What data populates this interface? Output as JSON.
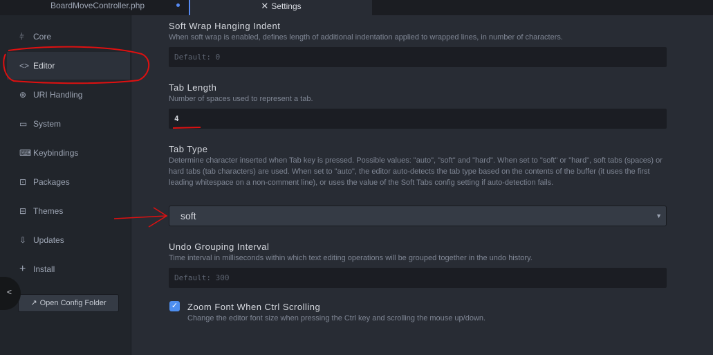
{
  "tabs": {
    "file": "BoardMoveController.php",
    "settings_icon": "tools-icon",
    "settings_glyph": "✕",
    "settings": "Settings"
  },
  "sidebar": {
    "items": [
      {
        "icon": "sliders-icon",
        "glyph": "⫩",
        "label": "Core"
      },
      {
        "icon": "code-icon",
        "glyph": "<>",
        "label": "Editor"
      },
      {
        "icon": "link-icon",
        "glyph": "⊕",
        "label": "URI Handling"
      },
      {
        "icon": "monitor-icon",
        "glyph": "▭",
        "label": "System"
      },
      {
        "icon": "keyboard-icon",
        "glyph": "⌨",
        "label": "Keybindings"
      },
      {
        "icon": "package-icon",
        "glyph": "⊡",
        "label": "Packages"
      },
      {
        "icon": "paintcan-icon",
        "glyph": "⊟",
        "label": "Themes"
      },
      {
        "icon": "cloud-download-icon",
        "glyph": "⇩",
        "label": "Updates"
      },
      {
        "icon": "plus-icon",
        "glyph": "+",
        "label": "Install"
      }
    ],
    "active": "Editor",
    "collapse_glyph": "<",
    "config_button_icon": "link-external-icon",
    "config_button_glyph": "↗",
    "config_button": "Open Config Folder"
  },
  "settings": {
    "soft_wrap": {
      "title": "Soft Wrap Hanging Indent",
      "description": "When soft wrap is enabled, defines length of additional indentation applied to wrapped lines, in number of characters.",
      "placeholder": "Default: 0"
    },
    "tab_length": {
      "title": "Tab Length",
      "description": "Number of spaces used to represent a tab.",
      "value": "4"
    },
    "tab_type": {
      "title": "Tab Type",
      "description": "Determine character inserted when Tab key is pressed. Possible values: \"auto\", \"soft\" and \"hard\". When set to \"soft\" or \"hard\", soft tabs (spaces) or hard tabs (tab characters) are used. When set to \"auto\", the editor auto-detects the tab type based on the contents of the buffer (it uses the first leading whitespace on a non-comment line), or uses the value of the Soft Tabs config setting if auto-detection fails.",
      "value": "soft",
      "arrow": "▼"
    },
    "undo_grouping": {
      "title": "Undo Grouping Interval",
      "description": "Time interval in milliseconds within which text editing operations will be grouped together in the undo history.",
      "placeholder": "Default: 300"
    },
    "zoom_font": {
      "title": "Zoom Font When Ctrl Scrolling",
      "description": "Change the editor font size when pressing the Ctrl key and scrolling the mouse up/down.",
      "checked": true,
      "check_glyph": "✓"
    }
  },
  "colors": {
    "accent": "#568af2",
    "annotation": "#e01010"
  }
}
